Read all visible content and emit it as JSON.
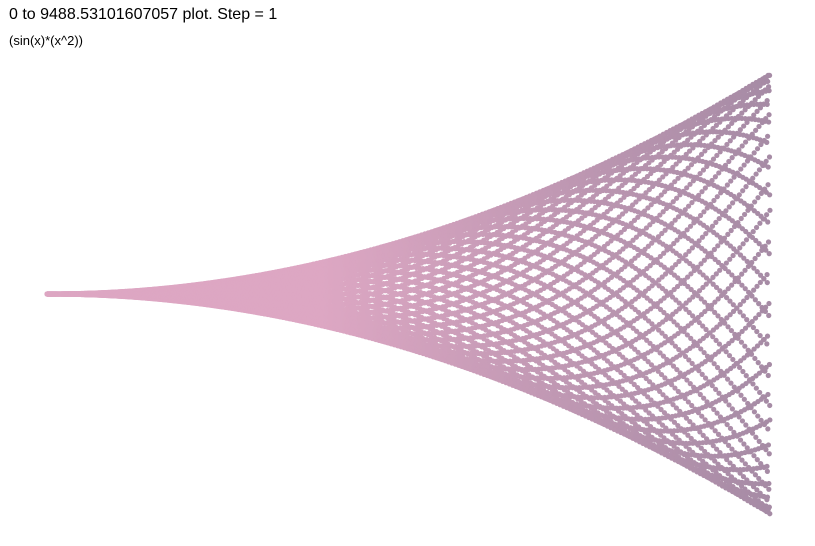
{
  "chart_data": {
    "type": "scatter",
    "title": "0 to 9488.53101607057 plot. Step = 1",
    "subtitle": "(sin(x)*(x^2))",
    "function": "sin(x)*(x^2)",
    "x_range": [
      0,
      9488.53101607057
    ],
    "step": 1,
    "y_range": [
      -90032220.6,
      90032220.6
    ],
    "xlabel": "",
    "ylabel": "",
    "grid": false,
    "legend": "none",
    "color_start": "#dda7c3",
    "color_end": "#a68ba5",
    "series": [
      {
        "values_rule": "y = sin(x)*x^2 for x = 0, 1, 2, ..., 9488"
      }
    ]
  }
}
